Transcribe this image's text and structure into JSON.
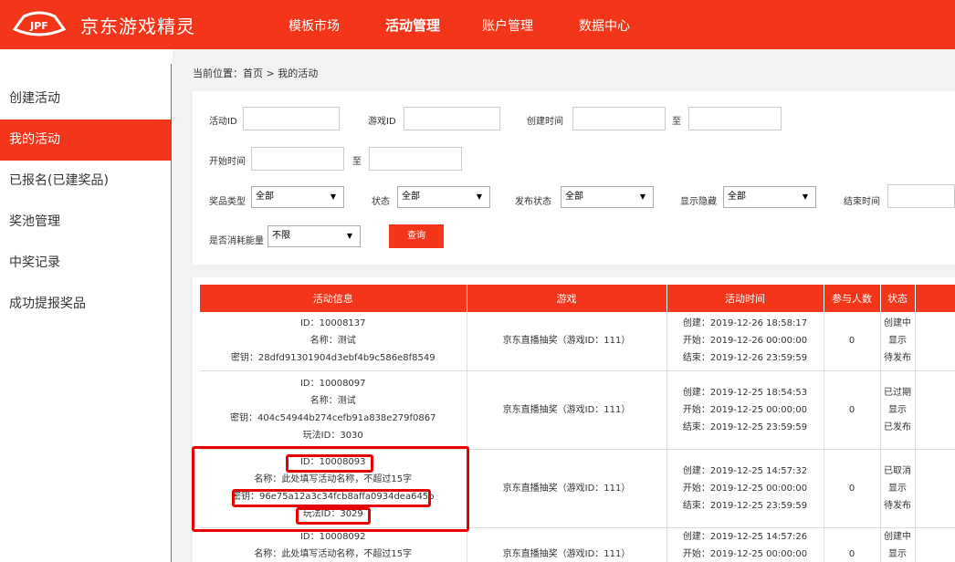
{
  "header": {
    "brand": "京东游戏精灵",
    "nav": [
      "模板市场",
      "活动管理",
      "账户管理",
      "数据中心"
    ],
    "active_nav": "活动管理"
  },
  "sidebar": {
    "items": [
      "创建活动",
      "我的活动",
      "已报名(已建奖品)",
      "奖池管理",
      "中奖记录",
      "成功提报奖品"
    ],
    "active": "我的活动"
  },
  "breadcrumb": "当前位置：首页 > 我的活动",
  "filters": {
    "activity_id": "活动ID",
    "game_id": "游戏ID",
    "created_time": "创建时间",
    "to1": "至",
    "start_time": "开始时间",
    "to2": "至",
    "prize_type": "奖品类型",
    "prize_type_value": "全部",
    "status": "状态",
    "status_value": "全部",
    "publish_status": "发布状态",
    "publish_status_value": "全部",
    "display": "显示隐藏",
    "display_value": "全部",
    "end_time": "结束时间",
    "consume_energy": "是否消耗能量",
    "consume_energy_value": "不限",
    "query_button": "查询"
  },
  "table": {
    "headers": [
      "活动信息",
      "游戏",
      "活动时间",
      "参与人数",
      "状态"
    ],
    "rows": [
      {
        "info": [
          "ID：10008137",
          "名称：测试",
          "密钥：28dfd91301904d3ebf4b9c586e8f8549"
        ],
        "game": "京东直播抽奖（游戏ID：111）",
        "time": [
          "创建：2019-12-26 18:58:17",
          "开始：2019-12-26 00:00:00",
          "结束：2019-12-26 23:59:59"
        ],
        "participants": "0",
        "status": [
          "创建中",
          "显示",
          "待发布"
        ]
      },
      {
        "info": [
          "ID：10008097",
          "名称：测试",
          "密钥：404c54944b274cefb91a838e279f0867",
          "玩法ID：3030"
        ],
        "game": "京东直播抽奖（游戏ID：111）",
        "time": [
          "创建：2019-12-25 18:54:53",
          "开始：2019-12-25 00:00:00",
          "结束：2019-12-25 23:59:59"
        ],
        "participants": "0",
        "status": [
          "已过期",
          "显示",
          "已发布"
        ]
      },
      {
        "info": [
          "ID：10008093",
          "名称：此处填写活动名称，不超过15字",
          "密钥：96e75a12a3c34fcb8affa0934dea645b",
          "玩法ID：3029"
        ],
        "game": "京东直播抽奖（游戏ID：111）",
        "time": [
          "创建：2019-12-25 14:57:32",
          "开始：2019-12-25 00:00:00",
          "结束：2019-12-25 23:59:59"
        ],
        "participants": "0",
        "status": [
          "已取消",
          "显示",
          "待发布"
        ]
      },
      {
        "info": [
          "ID：10008092",
          "名称：此处填写活动名称，不超过15字"
        ],
        "game": "京东直播抽奖（游戏ID：111）",
        "time": [
          "创建：2019-12-25 14:57:26",
          "开始：2019-12-25 00:00:00"
        ],
        "participants": "0",
        "status": [
          "创建中",
          "显示"
        ]
      }
    ]
  },
  "colors": {
    "brand": "#f33519",
    "highlight": "#e60000"
  }
}
